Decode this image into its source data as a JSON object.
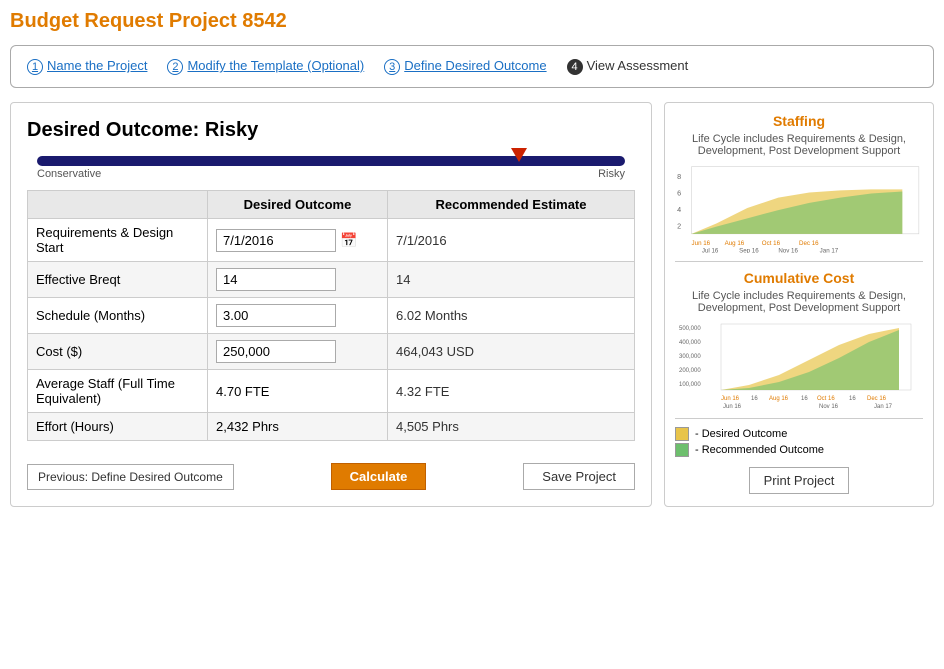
{
  "header": {
    "title": "Budget Request Project 8542"
  },
  "steps": [
    {
      "num": "1",
      "label": "Name the Project",
      "active": false
    },
    {
      "num": "2",
      "label": "Modify the Template (Optional)",
      "active": false
    },
    {
      "num": "3",
      "label": "Define Desired Outcome",
      "active": false
    },
    {
      "num": "4",
      "label": "View Assessment",
      "active": true
    }
  ],
  "left": {
    "outcome_title": "Desired Outcome: Risky",
    "slider_left_label": "Conservative",
    "slider_right_label": "Risky",
    "table": {
      "col1": "Desired Outcome",
      "col2": "Recommended Estimate",
      "rows": [
        {
          "label": "Requirements & Design Start",
          "desired": "7/1/2016",
          "recommended": "7/1/2016",
          "input_type": "date"
        },
        {
          "label": "Effective Breqt",
          "desired": "14",
          "recommended": "14",
          "input_type": "text"
        },
        {
          "label": "Schedule (Months)",
          "desired": "3.00",
          "recommended": "6.02 Months",
          "input_type": "text"
        },
        {
          "label": "Cost ($)",
          "desired": "250,000",
          "recommended": "464,043 USD",
          "input_type": "text"
        },
        {
          "label": "Average Staff (Full Time Equivalent)",
          "desired": "4.70 FTE",
          "recommended": "4.32 FTE",
          "input_type": "readonly"
        },
        {
          "label": "Effort (Hours)",
          "desired": "2,432 Phrs",
          "recommended": "4,505 Phrs",
          "input_type": "readonly"
        }
      ]
    },
    "btn_prev": "Previous: Define Desired Outcome",
    "btn_calculate": "Calculate",
    "btn_save": "Save Project"
  },
  "right": {
    "staffing_title": "Staffing",
    "staffing_subtitle": "Life Cycle includes Requirements & Design, Development, Post Development Support",
    "cumcost_title": "Cumulative Cost",
    "cumcost_subtitle": "Life Cycle includes Requirements & Design, Development, Post Development Support",
    "legend": [
      {
        "label": "- Desired Outcome",
        "color": "#e8c44a"
      },
      {
        "label": "- Recommended Outcome",
        "color": "#6dbf6d"
      }
    ],
    "btn_print": "Print Project",
    "staffing_x_labels": [
      "Jun 16",
      "Aug 16",
      "Oct 16",
      "Dec 16",
      "Jul 16",
      "Sep 16",
      "Nov 16",
      "Jan 17"
    ],
    "staffing_y_labels": [
      "8",
      "6",
      "4",
      "2"
    ],
    "cost_x_labels": [
      "Jun 16",
      "Aug 16",
      "Oct 16",
      "Dec 16",
      "Jan 17"
    ],
    "cost_y_labels": [
      "500,000",
      "400,000",
      "300,000",
      "200,000",
      "100,000"
    ]
  }
}
